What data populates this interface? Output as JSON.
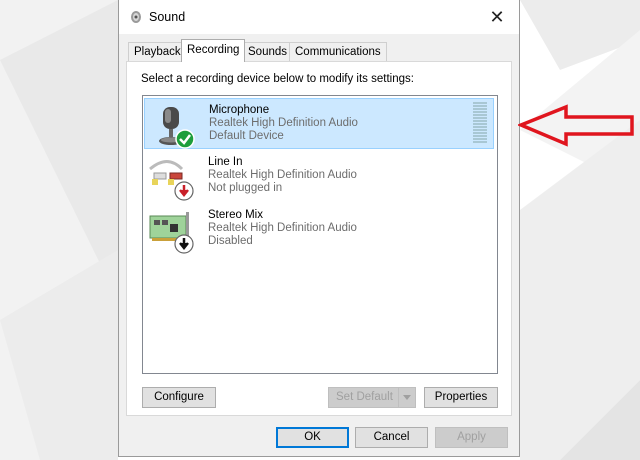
{
  "window": {
    "title": "Sound",
    "close_glyph": "✕"
  },
  "tabs": [
    {
      "label": "Playback",
      "active": false
    },
    {
      "label": "Recording",
      "active": true
    },
    {
      "label": "Sounds",
      "active": false
    },
    {
      "label": "Communications",
      "active": false
    }
  ],
  "recording": {
    "instruction": "Select a recording device below to modify its settings:",
    "devices": [
      {
        "name": "Microphone",
        "driver": "Realtek High Definition Audio",
        "status": "Default Device",
        "icon": "microphone-icon",
        "badge": "green-check-badge",
        "selected": true
      },
      {
        "name": "Line In",
        "driver": "Realtek High Definition Audio",
        "status": "Not plugged in",
        "icon": "line-in-cable-icon",
        "badge": "red-down-arrow-badge",
        "selected": false
      },
      {
        "name": "Stereo Mix",
        "driver": "Realtek High Definition Audio",
        "status": "Disabled",
        "icon": "sound-card-icon",
        "badge": "black-down-arrow-badge",
        "selected": false
      }
    ],
    "buttons": {
      "configure": "Configure",
      "set_default": "Set Default",
      "properties": "Properties"
    }
  },
  "footer": {
    "ok": "OK",
    "cancel": "Cancel",
    "apply": "Apply"
  },
  "annotation": {
    "icon": "red-arrow-pointer",
    "color": "#e0151e"
  },
  "colors": {
    "selection": "#cce8ff",
    "accent": "#0078d7",
    "check_badge": "#1e9e3c"
  }
}
